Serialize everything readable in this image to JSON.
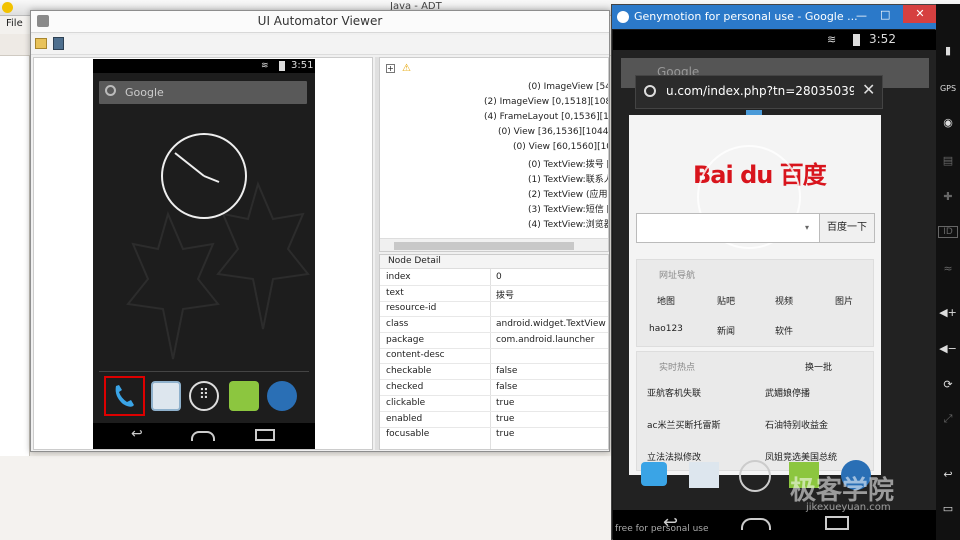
{
  "adt": {
    "title": "Java - ADT",
    "menu_file": "File"
  },
  "viewer": {
    "title": "UI Automator Viewer",
    "phone": {
      "time": "3:51",
      "search_placeholder": "Google"
    },
    "tree": [
      "(0) ImageView [54,1",
      "(2) ImageView [0,1518][1080,1",
      "(4) FrameLayout [0,1536][1080",
      "(0) View [36,1536][1044,17",
      "(0) View [60,1560][1020",
      "(0) TextView:拨号 [6",
      "(1) TextView:联系人",
      "(2) TextView (应用) [",
      "(3) TextView:短信 [6",
      "(4) TextView:浏览器"
    ],
    "node_detail": {
      "header": "Node Detail",
      "rows": [
        {
          "key": "index",
          "value": "0"
        },
        {
          "key": "text",
          "value": "拨号"
        },
        {
          "key": "resource-id",
          "value": ""
        },
        {
          "key": "class",
          "value": "android.widget.TextView"
        },
        {
          "key": "package",
          "value": "com.android.launcher"
        },
        {
          "key": "content-desc",
          "value": ""
        },
        {
          "key": "checkable",
          "value": "false"
        },
        {
          "key": "checked",
          "value": "false"
        },
        {
          "key": "clickable",
          "value": "true"
        },
        {
          "key": "enabled",
          "value": "true"
        },
        {
          "key": "focusable",
          "value": "true"
        }
      ]
    }
  },
  "genymotion": {
    "title": "Genymotion for personal use - Google ...",
    "time": "3:52",
    "url": "u.com/index.php?tn=28035039",
    "search_underlay": "Google",
    "baidu_logo": "Bai du 百度",
    "search_button": "百度一下",
    "nav_header": "网址导航",
    "nav_links": [
      "地图",
      "贴吧",
      "视频",
      "图片",
      "hao123",
      "新闻",
      "软件"
    ],
    "hot_header": "实时热点",
    "hot_refresh": "换一批",
    "hot_items": [
      "亚航客机失联",
      "武媚娘停播",
      "ac米兰买断托雷斯",
      "石油特别收益金",
      "立法法拟修改",
      "凤姐竞选美国总统"
    ],
    "footer": "free for personal use",
    "side_labels": {
      "gps": "GPS",
      "id": "ID"
    }
  },
  "watermark": {
    "main": "极客学院",
    "sub": "jikexueyuan.com"
  },
  "colors": {
    "geny_titlebar": "#2b79c9",
    "selection": "#dd0000",
    "baidu_red": "#d8141c"
  }
}
